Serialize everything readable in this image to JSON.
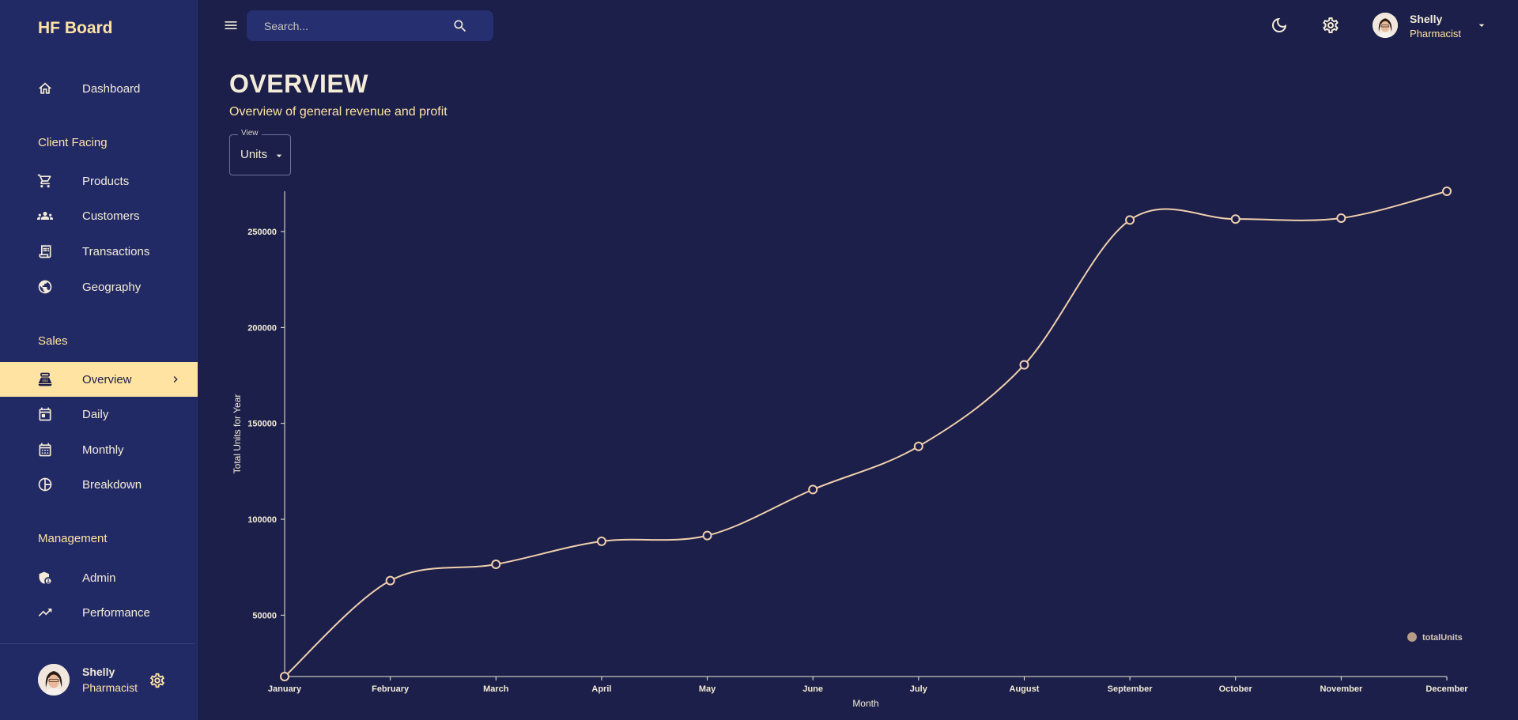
{
  "sidebar": {
    "brand": "HF Board",
    "dashboard": "Dashboard",
    "section_client": "Client Facing",
    "products": "Products",
    "customers": "Customers",
    "transactions": "Transactions",
    "geography": "Geography",
    "section_sales": "Sales",
    "overview": "Overview",
    "daily": "Daily",
    "monthly": "Monthly",
    "breakdown": "Breakdown",
    "section_management": "Management",
    "admin": "Admin",
    "performance": "Performance",
    "user_name": "Shelly",
    "user_role": "Pharmacist"
  },
  "topbar": {
    "search_placeholder": "Search...",
    "user_name": "Shelly",
    "user_role": "Pharmacist"
  },
  "header": {
    "title": "OVERVIEW",
    "subtitle": "Overview of general revenue and profit"
  },
  "view_select": {
    "label": "View",
    "value": "Units"
  },
  "colors": {
    "background": "#1b1f49",
    "sidebar": "#222a66",
    "accent": "#ffe3a3",
    "line": "#f1cfae",
    "text": "#f4ecd8"
  },
  "chart_data": {
    "type": "line",
    "xlabel": "Month",
    "ylabel": "Total Units for Year",
    "categories": [
      "January",
      "February",
      "March",
      "April",
      "May",
      "June",
      "July",
      "August",
      "September",
      "October",
      "November",
      "December"
    ],
    "series": [
      {
        "name": "totalUnits",
        "values": [
          18000,
          68000,
          76500,
          88500,
          91500,
          115500,
          138000,
          180500,
          256000,
          256500,
          257000,
          271000
        ]
      }
    ],
    "ylim": [
      18000,
      271000
    ],
    "yticks": [
      50000,
      100000,
      150000,
      200000,
      250000
    ],
    "grid": false,
    "legend": "bottom-right"
  }
}
